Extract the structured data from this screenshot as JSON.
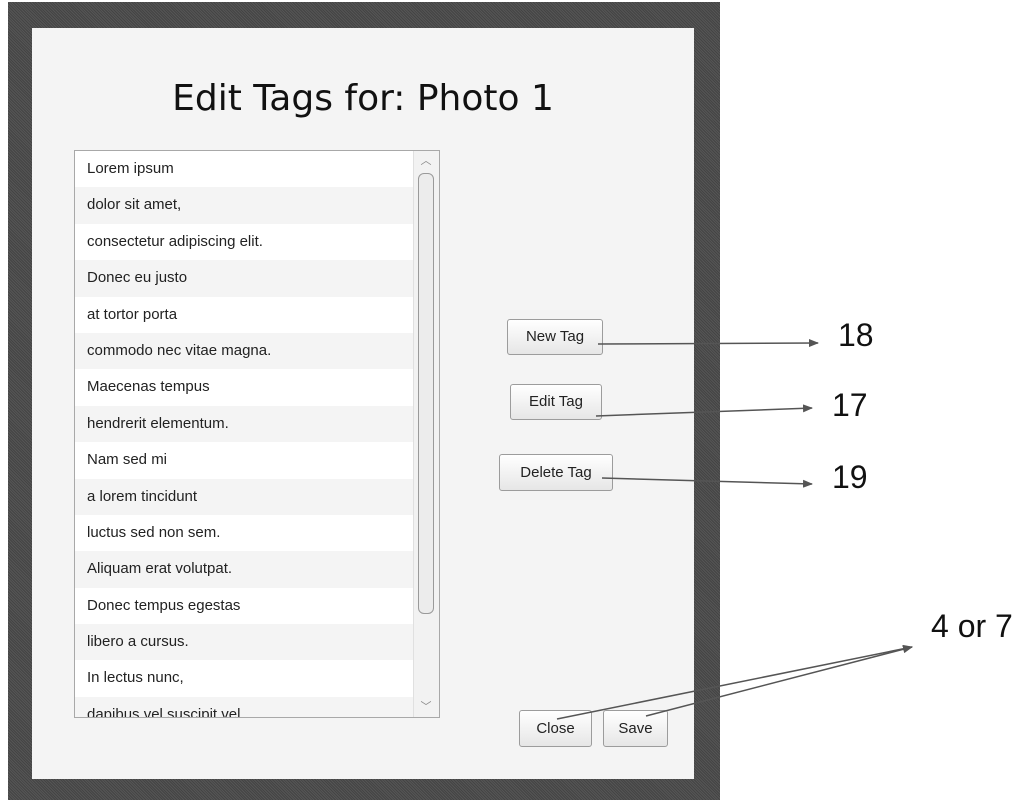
{
  "dialog": {
    "title": "Edit Tags for: Photo 1",
    "tags": [
      "Lorem ipsum",
      "dolor sit amet,",
      "consectetur adipiscing elit.",
      "Donec eu justo",
      "at tortor porta",
      "commodo nec vitae magna.",
      "Maecenas tempus",
      "hendrerit elementum.",
      "Nam sed mi",
      "a lorem tincidunt",
      "luctus sed non sem.",
      "Aliquam erat volutpat.",
      "Donec tempus egestas",
      "libero a cursus.",
      "In lectus nunc,",
      "dapibus vel suscipit vel,"
    ],
    "buttons": {
      "new_tag": "New Tag",
      "edit_tag": "Edit Tag",
      "delete_tag": "Delete Tag",
      "close": "Close",
      "save": "Save"
    }
  },
  "annotations": {
    "new_tag": "18",
    "edit_tag": "17",
    "delete_tag": "19",
    "close_save": "4 or 7"
  },
  "icons": {
    "scroll_up": "chevron-up-icon",
    "scroll_down": "chevron-down-icon"
  },
  "colors": {
    "window_bg": "#f4f4f4",
    "frame_bg": "#4a4a4a",
    "arrow": "#555555"
  }
}
